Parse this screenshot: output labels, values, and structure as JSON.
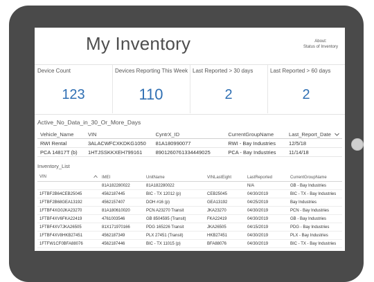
{
  "page": {
    "title": "My Inventory",
    "about_line1": "About:",
    "about_line2": "Status of Inventory"
  },
  "cards": [
    {
      "label": "Device Count",
      "value": "123"
    },
    {
      "label": "Devices Reporting This Week",
      "value": "110"
    },
    {
      "label": "Last Reported > 30 days",
      "value": "2"
    },
    {
      "label": "Last Reported > 60 days",
      "value": "2"
    }
  ],
  "active_table": {
    "title": "Active_No_Data_in_30_Or_More_Days",
    "columns": [
      "Vehicle_Name",
      "VIN",
      "CyntrX_ID",
      "CurrentGroupName",
      "Last_Report_Date"
    ],
    "sort_icon": "chevron-down-icon",
    "rows": [
      [
        "RWI Rental",
        "3ALACWFCXKDKG1050",
        "81A180990077",
        "RWI - Bay Industries",
        "12/5/18"
      ],
      [
        "PCA 14817T (b)",
        "1HTJSSKKXEH799161",
        "8901260761334449025",
        "PCA - Bay Industries",
        "11/14/18"
      ]
    ]
  },
  "inventory_table": {
    "title": "Inventory_List",
    "columns": [
      "VIN",
      "IMEI",
      "UnitName",
      "VINLastEight",
      "LastReported",
      "CurrentGroupName"
    ],
    "sort_icon": "caret-up-icon",
    "rows": [
      [
        "",
        "81A182280022",
        "81A182280022",
        "",
        "N/A",
        "GB - Bay Industries"
      ],
      [
        "1FTBF2B64CEB25045",
        "4562187445",
        "BIC - TX 12012 (p)",
        "CEB25045",
        "04/30/2019",
        "BIC - TX - Bay Industries"
      ],
      [
        "1FTBF2B68GEA13192",
        "4562157407",
        "DOH #16 (p)",
        "GEA13192",
        "04/25/2019",
        "Bay Industries"
      ],
      [
        "1FTBF4XG0JKA23270",
        "81A180610020",
        "PCN A23270 Transit",
        "JKA23270",
        "04/30/2019",
        "PCN - Bay Industries"
      ],
      [
        "1FTBF4XV6FKA22419",
        "4761003546",
        "GB 8504595 (Transit)",
        "FKA22419",
        "04/30/2019",
        "GB - Bay Industries"
      ],
      [
        "1FTBF4XV7JKA26505",
        "81X171970166",
        "PDG 165226 Transit",
        "JKA26505",
        "04/15/2019",
        "PDG - Bay Industries"
      ],
      [
        "1FTBF4XV8HKB27451",
        "4562187349",
        "PLX 27451 (Transit)",
        "HKB27451",
        "04/30/2019",
        "PLX - Bay Industries"
      ],
      [
        "1FTFW1CF0BFA88076",
        "4562187446",
        "BIC - TX 11015 (p)",
        "BFA88076",
        "04/30/2019",
        "BIC - TX - Bay Industries"
      ]
    ]
  },
  "colors": {
    "accent": "#2f6fb3",
    "bezel": "#4a4a4a"
  }
}
